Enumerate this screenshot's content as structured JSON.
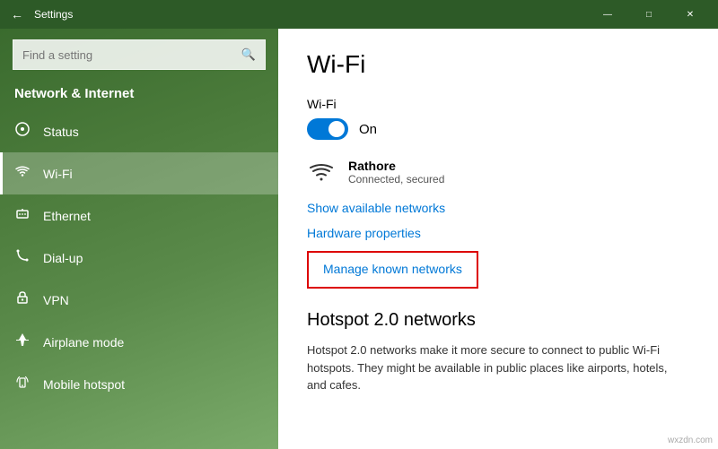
{
  "titleBar": {
    "title": "Settings",
    "backLabel": "←",
    "minimizeLabel": "—",
    "maximizeLabel": "□",
    "closeLabel": "✕"
  },
  "sidebar": {
    "searchPlaceholder": "Find a setting",
    "sectionTitle": "Network & Internet",
    "items": [
      {
        "id": "status",
        "label": "Status",
        "icon": "⊙"
      },
      {
        "id": "wifi",
        "label": "Wi-Fi",
        "icon": "((·))"
      },
      {
        "id": "ethernet",
        "label": "Ethernet",
        "icon": "🖥"
      },
      {
        "id": "dialup",
        "label": "Dial-up",
        "icon": "☎"
      },
      {
        "id": "vpn",
        "label": "VPN",
        "icon": "🔒"
      },
      {
        "id": "airplane",
        "label": "Airplane mode",
        "icon": "✈"
      },
      {
        "id": "mobile",
        "label": "Mobile hotspot",
        "icon": "📶"
      }
    ]
  },
  "content": {
    "title": "Wi-Fi",
    "wifiLabel": "Wi-Fi",
    "toggleState": "On",
    "network": {
      "name": "Rathore",
      "status": "Connected, secured"
    },
    "showNetworksLink": "Show available networks",
    "hardwarePropertiesLink": "Hardware properties",
    "manageKnownNetworks": "Manage known networks",
    "hotspotTitle": "Hotspot 2.0 networks",
    "hotspotDesc": "Hotspot 2.0 networks make it more secure to connect to public Wi-Fi hotspots. They might be available in public places like airports, hotels, and cafes."
  },
  "watermark": "wxzdn.com"
}
